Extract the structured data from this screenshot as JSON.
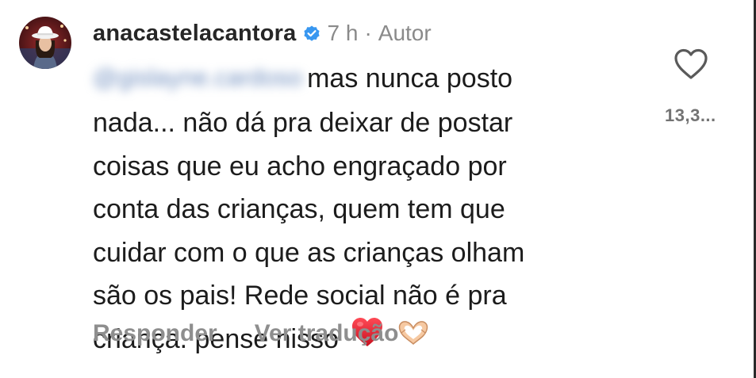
{
  "comment": {
    "author": "anacastelacantora",
    "time": "7 h",
    "separator": "·",
    "author_badge": "Autor",
    "mention": "@gislayne.cardoso",
    "text_lines": [
      "mas nunca posto",
      "nada... não dá pra deixar de postar",
      "coisas que eu acho engraçado por",
      "conta das crianças, quem tem que",
      "cuidar com o que as crianças olham",
      "são os pais! Rede social não é pra",
      "criança. pense nisso"
    ],
    "emojis": [
      "red-heart-icon",
      "heart-hands-icon"
    ],
    "like_count": "13,3...",
    "actions": {
      "reply": "Responder",
      "translate": "Ver tradução"
    }
  },
  "colors": {
    "verified_blue": "#3897f0",
    "heart_red": "#e0172b",
    "muted_text": "#8e8e8e"
  }
}
